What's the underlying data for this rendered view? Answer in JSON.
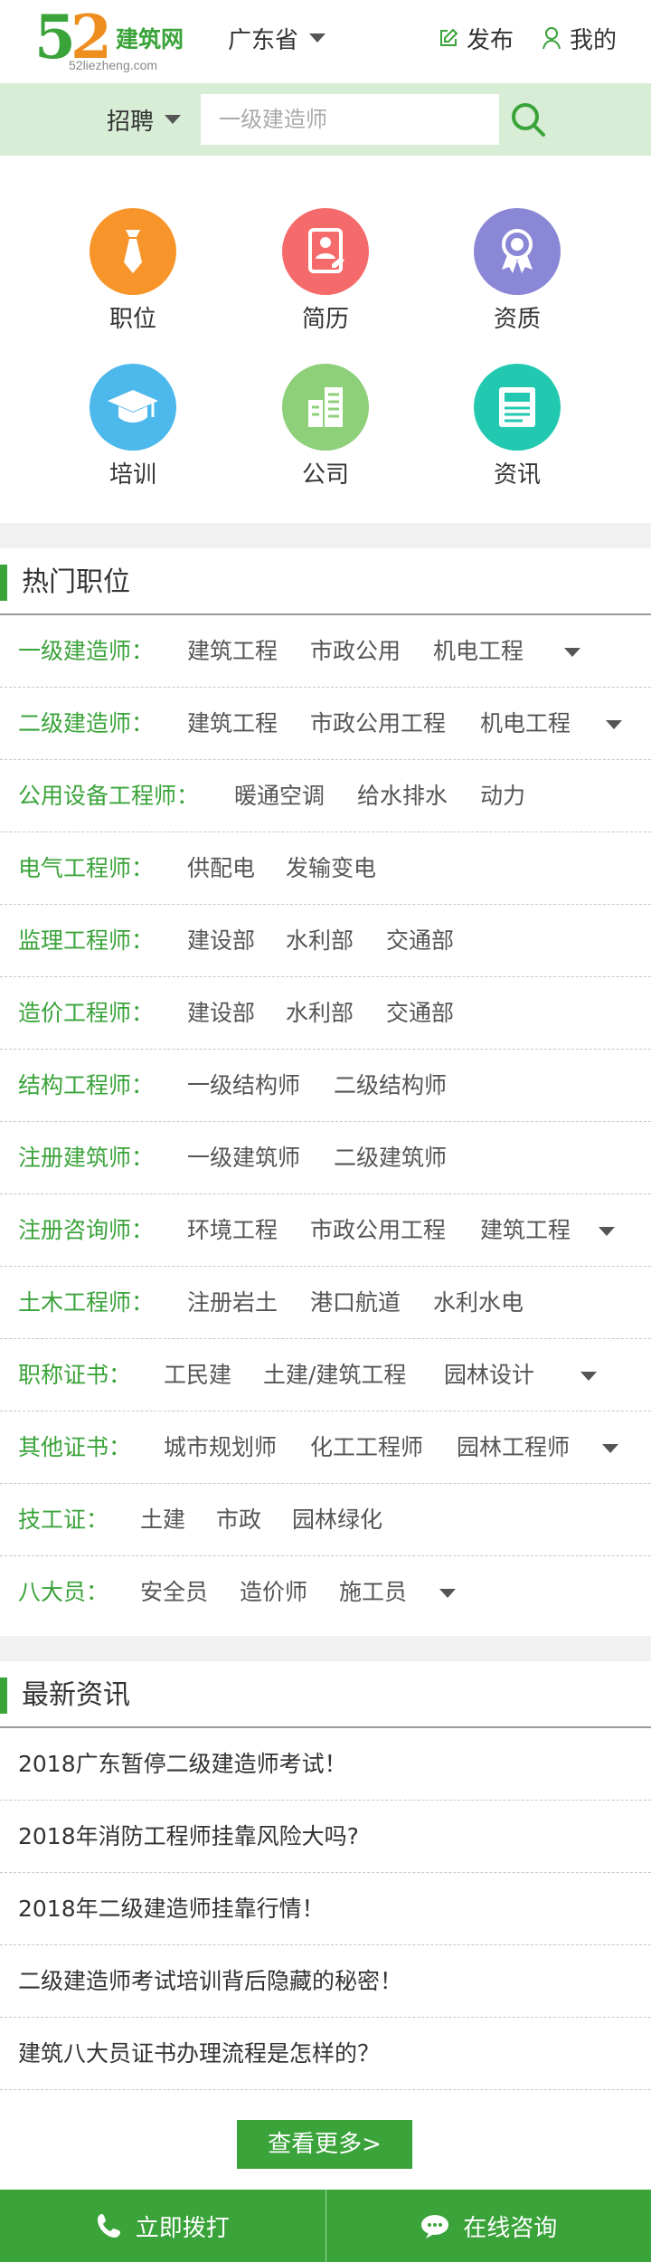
{
  "header": {
    "logo_digits_1": "5",
    "logo_digits_2": "2",
    "logo_text": "建筑网",
    "logo_url": "52liezheng.com",
    "province": "广东省",
    "publish_label": "发布",
    "mine_label": "我的"
  },
  "search": {
    "type_label": "招聘",
    "placeholder": "一级建造师"
  },
  "categories": [
    {
      "label": "职位",
      "icon": "tie-icon",
      "color": "#f7952b"
    },
    {
      "label": "简历",
      "icon": "resume-icon",
      "color": "#f56b6b"
    },
    {
      "label": "资质",
      "icon": "award-icon",
      "color": "#8a87d6"
    },
    {
      "label": "培训",
      "icon": "graduation-cap-icon",
      "color": "#4cb8ec"
    },
    {
      "label": "公司",
      "icon": "building-icon",
      "color": "#8ed07a"
    },
    {
      "label": "资讯",
      "icon": "news-icon",
      "color": "#22c9b0"
    }
  ],
  "hot_jobs": {
    "title": "热门职位",
    "rows": [
      {
        "category": "一级建造师：",
        "tags": [
          "建筑工程",
          "市政公用",
          "机电工程"
        ],
        "has_more": true
      },
      {
        "category": "二级建造师：",
        "tags": [
          "建筑工程",
          "市政公用工程",
          "机电工程"
        ],
        "has_more": true
      },
      {
        "category": "公用设备工程师：",
        "tags": [
          "暖通空调",
          "给水排水",
          "动力"
        ],
        "has_more": false
      },
      {
        "category": "电气工程师：",
        "tags": [
          "供配电",
          "发输变电"
        ],
        "has_more": false
      },
      {
        "category": "监理工程师：",
        "tags": [
          "建设部",
          "水利部",
          "交通部"
        ],
        "has_more": false
      },
      {
        "category": "造价工程师：",
        "tags": [
          "建设部",
          "水利部",
          "交通部"
        ],
        "has_more": false
      },
      {
        "category": "结构工程师：",
        "tags": [
          "一级结构师",
          "二级结构师"
        ],
        "has_more": false
      },
      {
        "category": "注册建筑师：",
        "tags": [
          "一级建筑师",
          "二级建筑师"
        ],
        "has_more": false
      },
      {
        "category": "注册咨询师：",
        "tags": [
          "环境工程",
          "市政公用工程",
          "建筑工程"
        ],
        "has_more": true
      },
      {
        "category": "土木工程师：",
        "tags": [
          "注册岩土",
          "港口航道",
          "水利水电"
        ],
        "has_more": false
      },
      {
        "category": "职称证书：",
        "tags": [
          "工民建",
          "土建/建筑工程",
          "园林设计"
        ],
        "has_more": true
      },
      {
        "category": "其他证书：",
        "tags": [
          "城市规划师",
          "化工工程师",
          "园林工程师"
        ],
        "has_more": true
      },
      {
        "category": "技工证：",
        "tags": [
          "土建",
          "市政",
          "园林绿化"
        ],
        "has_more": false
      },
      {
        "category": "八大员：",
        "tags": [
          "安全员",
          "造价师",
          "施工员"
        ],
        "has_more": true
      }
    ]
  },
  "news": {
    "title": "最新资讯",
    "items": [
      "2018广东暂停二级建造师考试！",
      "2018年消防工程师挂靠风险大吗?",
      "2018年二级建造师挂靠行情！",
      "二级建造师考试培训背后隐藏的秘密！",
      "建筑八大员证书办理流程是怎样的？"
    ],
    "more_label": "查看更多>"
  },
  "footer": {
    "call_label": "立即拨打",
    "consult_label": "在线咨询"
  },
  "colors": {
    "brand_green": "#3aa33a",
    "logo_orange": "#ee8e1e",
    "search_bg": "#d7edd6"
  }
}
